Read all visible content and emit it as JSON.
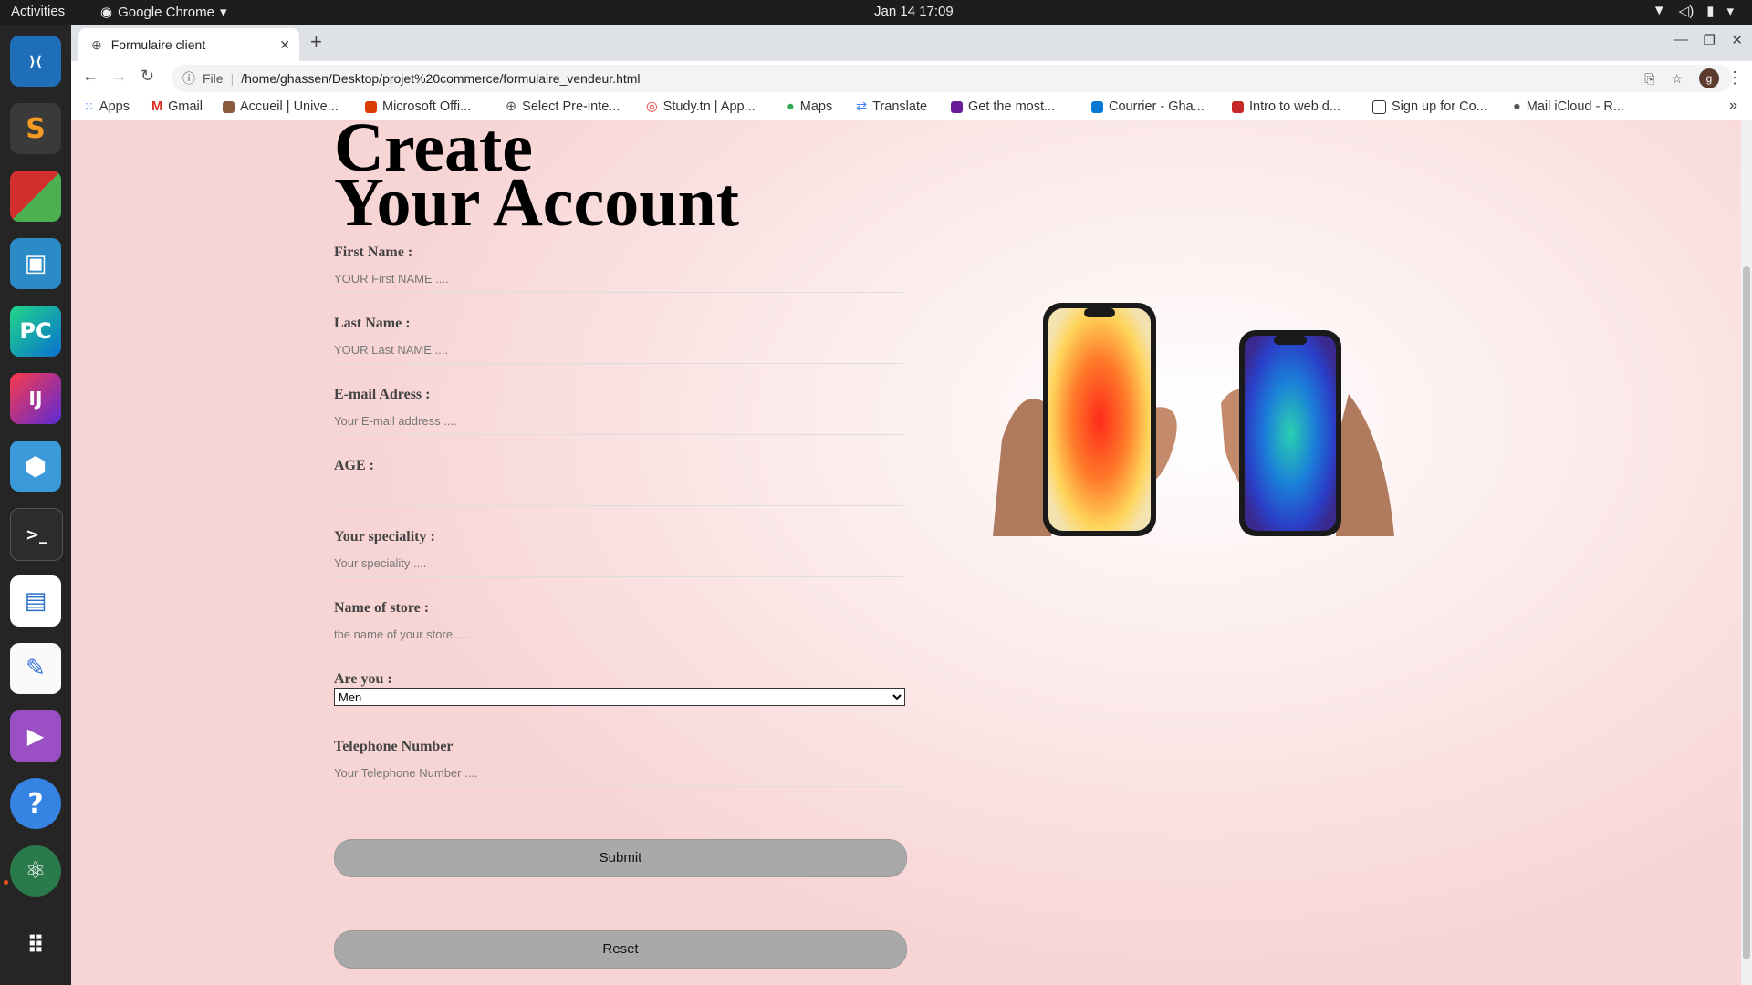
{
  "topbar": {
    "activities": "Activities",
    "app_name": "Google Chrome",
    "clock": "Jan 14  17:09"
  },
  "dock": {
    "items": [
      "VS Code",
      "Sublime Text",
      "App",
      "App",
      "PyCharm",
      "IntelliJ IDEA",
      "App",
      "Terminal",
      "Document Viewer",
      "Text Editor",
      "Videos",
      "Help",
      "Atom",
      "Show Applications"
    ]
  },
  "browser": {
    "tab_title": "Formulaire client",
    "url_scheme": "File",
    "url": "/home/ghassen/Desktop/projet%20commerce/formulaire_vendeur.html",
    "profile_initial": "g",
    "bookmarks": [
      "Apps",
      "Gmail",
      "Accueil | Unive...",
      "Microsoft Offi...",
      "Select Pre-inte...",
      "Study.tn | App...",
      "Maps",
      "Translate",
      "Get the most...",
      "Courrier - Gha...",
      "Intro to web d...",
      "Sign up for Co...",
      "Mail iCloud - R..."
    ]
  },
  "form": {
    "heading_line1": "Create",
    "heading_line2": "Your Account",
    "first_name_label": "First Name :",
    "first_name_placeholder": "YOUR First NAME ....",
    "last_name_label": "Last Name :",
    "last_name_placeholder": "YOUR Last NAME ....",
    "email_label": "E-mail Adress :",
    "email_placeholder": "Your E-mail address ....",
    "age_label": "AGE :",
    "speciality_label": "Your speciality :",
    "speciality_placeholder": "Your speciality ....",
    "store_label": "Name of store :",
    "store_placeholder": "the name of your store ....",
    "gender_label": "Are you :",
    "gender_selected": "Men",
    "phone_label": "Telephone Number",
    "phone_placeholder": "Your Telephone Number ....",
    "submit_label": "Submit",
    "reset_label": "Reset"
  },
  "colors": {
    "page_bg": "#f8d5d5",
    "button_bg": "#a9a9a9",
    "dock_bg": "#252525"
  }
}
